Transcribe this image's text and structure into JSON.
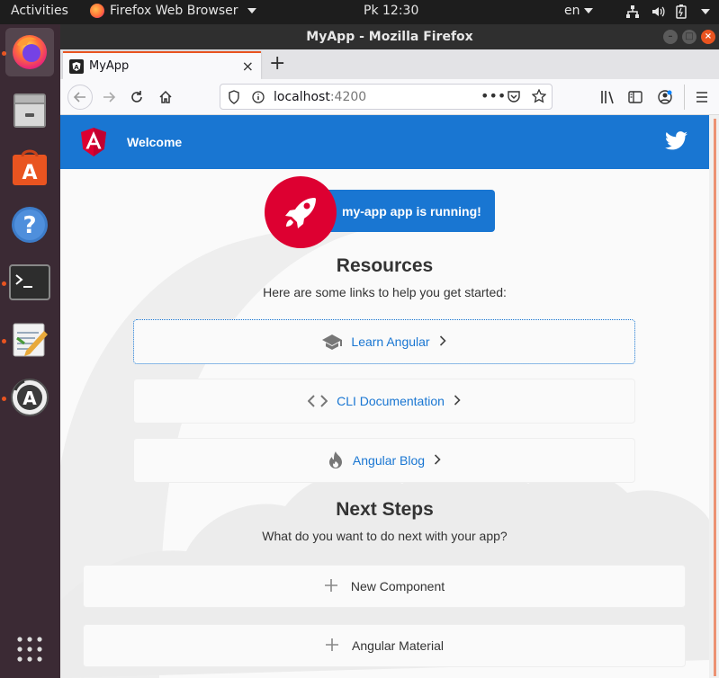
{
  "topbar": {
    "activities": "Activities",
    "app_name": "Firefox Web Browser",
    "clock": "Pk 12:30",
    "language": "en"
  },
  "dock": {
    "items": [
      {
        "name": "firefox-icon",
        "active": true
      },
      {
        "name": "files-icon"
      },
      {
        "name": "software-center-icon"
      },
      {
        "name": "help-icon"
      },
      {
        "name": "terminal-icon"
      },
      {
        "name": "text-editor-icon"
      },
      {
        "name": "software-updater-icon"
      },
      {
        "name": "show-apps-icon"
      }
    ]
  },
  "firefox": {
    "window_title": "MyApp - Mozilla Firefox",
    "tab_title": "MyApp",
    "url_host": "localhost",
    "url_port": ":4200"
  },
  "app": {
    "toolbar_title": "Welcome",
    "running_text": "my-app app is running!",
    "resources_heading": "Resources",
    "resources_sub": "Here are some links to help you get started:",
    "links": [
      {
        "label": "Learn Angular",
        "icon": "school-icon"
      },
      {
        "label": "CLI Documentation",
        "icon": "code-icon"
      },
      {
        "label": "Angular Blog",
        "icon": "flame-icon"
      }
    ],
    "next_heading": "Next Steps",
    "next_sub": "What do you want to do next with your app?",
    "next_steps": [
      {
        "label": "New Component"
      },
      {
        "label": "Angular Material"
      }
    ]
  },
  "colors": {
    "angular_red": "#dd0031",
    "angular_blue": "#1976d2",
    "ubuntu_orange": "#e95420"
  }
}
